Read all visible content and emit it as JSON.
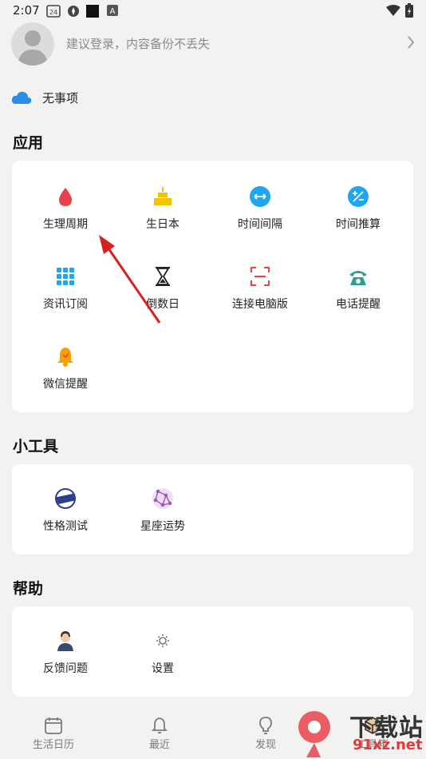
{
  "status_bar": {
    "time": "2:07",
    "calendar_badge": "24",
    "notif_letter": "A"
  },
  "profile": {
    "login_hint": "建议登录，内容备份不丢失"
  },
  "sync": {
    "label": "无事项"
  },
  "sections": {
    "apps_title": "应用",
    "tools_title": "小工具",
    "help_title": "帮助"
  },
  "apps": [
    {
      "label": "生理周期",
      "icon": "blood-drop-icon",
      "color": "#e8434b"
    },
    {
      "label": "生日本",
      "icon": "birthday-cake-icon",
      "color": "#f5c400"
    },
    {
      "label": "时间间隔",
      "icon": "double-arrow-icon",
      "color": "#1ea7f0"
    },
    {
      "label": "时间推算",
      "icon": "plus-minus-icon",
      "color": "#1ea7f0"
    },
    {
      "label": "资讯订阅",
      "icon": "grid-icon",
      "color": "#1ea7f0"
    },
    {
      "label": "倒数日",
      "icon": "hourglass-icon",
      "color": "#222222"
    },
    {
      "label": "连接电脑版",
      "icon": "scan-frame-icon",
      "color": "#e8434b"
    },
    {
      "label": "电话提醒",
      "icon": "telephone-icon",
      "color": "#2e9e8f"
    },
    {
      "label": "微信提醒",
      "icon": "bell-icon",
      "color": "#f5a000"
    }
  ],
  "tools": [
    {
      "label": "性格测试",
      "icon": "test-stamp-icon",
      "color": "#2c3e8f"
    },
    {
      "label": "星座运势",
      "icon": "constellation-icon",
      "color": "#9b59b6"
    }
  ],
  "help": [
    {
      "label": "反馈问题",
      "icon": "support-agent-icon",
      "color": "#3a4a6b"
    },
    {
      "label": "设置",
      "icon": "gear-icon",
      "color": "#777777"
    }
  ],
  "bottom_nav": [
    {
      "label": "生活日历",
      "icon": "calendar-icon"
    },
    {
      "label": "最近",
      "icon": "bell-outline-icon"
    },
    {
      "label": "发现",
      "icon": "lightbulb-icon"
    },
    {
      "label": "工具箱",
      "icon": "toolbox-icon"
    }
  ],
  "watermark": {
    "line1": "下载站",
    "line2": "91xz.net",
    "logo_text": "9"
  }
}
